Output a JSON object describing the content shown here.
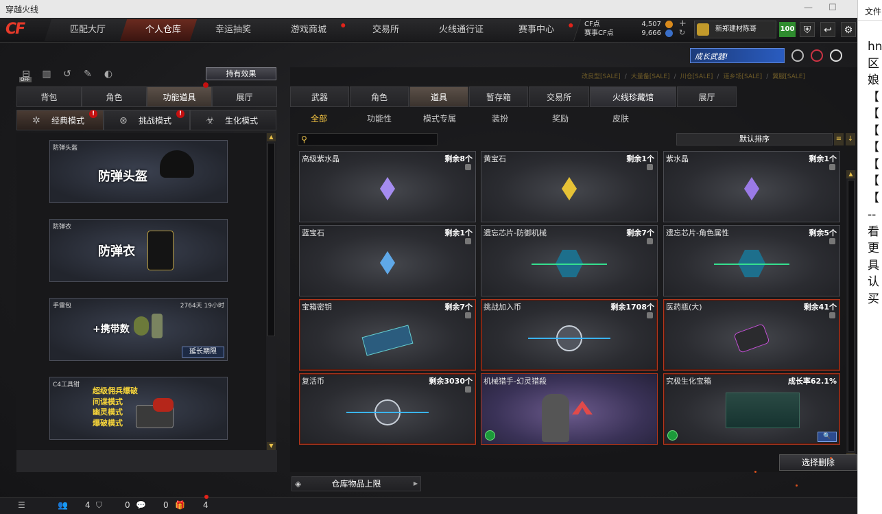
{
  "window": {
    "title": "穿越火线"
  },
  "nav": {
    "tabs": [
      {
        "label": "匹配大厅"
      },
      {
        "label": "个人仓库"
      },
      {
        "label": "幸运抽奖"
      },
      {
        "label": "游戏商城"
      },
      {
        "label": "交易所"
      },
      {
        "label": "火线通行证"
      },
      {
        "label": "赛事中心"
      }
    ],
    "cf_label": "CF点",
    "cf_value": "4,507",
    "event_cf_label": "赛事CF点",
    "event_cf_value": "9,666",
    "username": "新郑建材陈哥",
    "level": "100"
  },
  "promo": {
    "banner_text": "成长武器!",
    "sale_items": [
      "改良型[SALE]",
      "大量备[SALE]",
      "川仓[SALE]",
      "道乡场[SALE]",
      "翼服[SALE]"
    ]
  },
  "left": {
    "hold_effect_btn": "持有效果",
    "off_badge": "OFF",
    "tabs": [
      {
        "label": "背包"
      },
      {
        "label": "角色"
      },
      {
        "label": "功能道具"
      },
      {
        "label": "展厅"
      }
    ],
    "modes": [
      {
        "label": "经典模式"
      },
      {
        "label": "挑战模式"
      },
      {
        "label": "生化模式"
      }
    ],
    "items": [
      {
        "name": "防弹头盔",
        "big": "防弹头盔"
      },
      {
        "name": "防弹衣",
        "big": "防弹衣"
      },
      {
        "name": "手雷包",
        "remaining": "2764天 19小时",
        "big": "+携带数",
        "button": "延长期限"
      },
      {
        "name": "C4工具钳",
        "lines": [
          "超级佣兵爆破",
          "间谍模式",
          "幽灵模式",
          "爆破模式"
        ]
      }
    ]
  },
  "right": {
    "tabs": [
      {
        "label": "武器"
      },
      {
        "label": "角色"
      },
      {
        "label": "道具"
      },
      {
        "label": "暂存箱"
      },
      {
        "label": "交易所"
      },
      {
        "label": "火线珍藏馆"
      },
      {
        "label": "展厅"
      }
    ],
    "subtabs": [
      {
        "label": "全部"
      },
      {
        "label": "功能性"
      },
      {
        "label": "模式专属"
      },
      {
        "label": "装扮"
      },
      {
        "label": "奖励"
      },
      {
        "label": "皮肤"
      }
    ],
    "sort_label": "默认排序",
    "items": [
      {
        "name": "高级紫水晶",
        "count": "剩余8个"
      },
      {
        "name": "黄宝石",
        "count": "剩余1个"
      },
      {
        "name": "紫水晶",
        "count": "剩余1个"
      },
      {
        "name": "蓝宝石",
        "count": "剩余1个"
      },
      {
        "name": "遗忘芯片-防御机械",
        "count": "剩余7个"
      },
      {
        "name": "遗忘芯片-角色属性",
        "count": "剩余5个"
      },
      {
        "name": "宝箱密钥",
        "count": "剩余7个"
      },
      {
        "name": "挑战加入币",
        "count": "剩余1708个"
      },
      {
        "name": "医药瓶(大)",
        "count": "剩余41个"
      },
      {
        "name": "复活币",
        "count": "剩余3030个"
      },
      {
        "name": "机械猎手-幻灵猎殺",
        "count": ""
      },
      {
        "name": "究极生化宝箱",
        "count": "成长率62.1%"
      }
    ],
    "select_delete_btn": "选择删除",
    "capacity_label": "仓库物品上限"
  },
  "status": {
    "friends": "4",
    "shield": "0",
    "chat": "0",
    "gifts": "4"
  },
  "side_doc": {
    "menu": "文件",
    "lines": [
      "hn",
      "区",
      "娘",
      "【",
      "【",
      "【",
      "【",
      "【",
      "【",
      "【",
      "--",
      "看",
      "更",
      "具",
      "认",
      "买"
    ]
  },
  "colors": {
    "accent_gold": "#f5c542",
    "accent_red": "#e83a2a",
    "level_green": "#2f8c2f"
  }
}
